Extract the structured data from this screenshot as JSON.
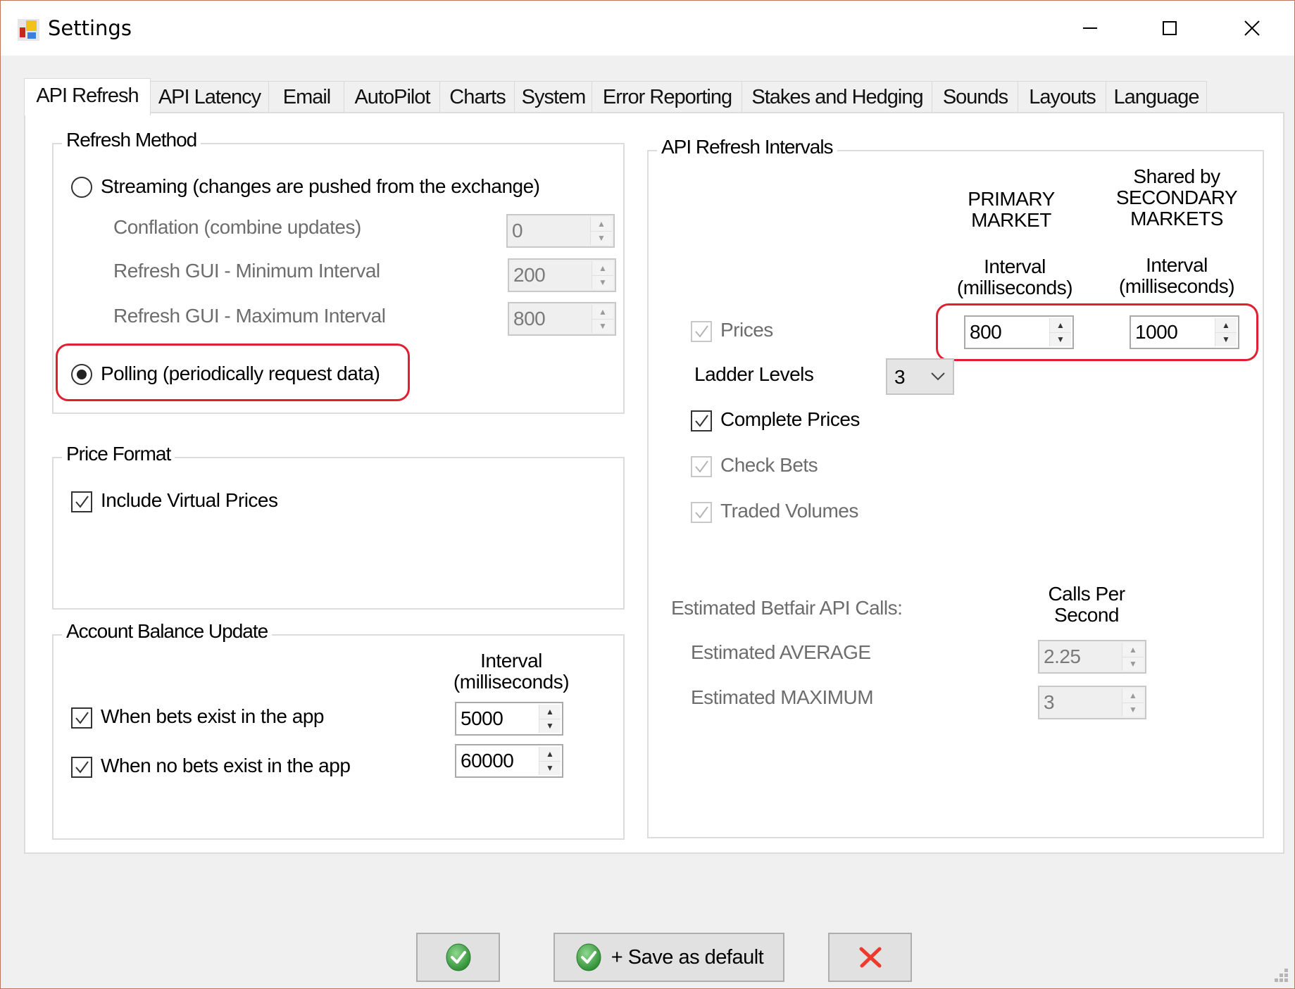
{
  "window": {
    "title": "Settings",
    "controls": {
      "minimize": "minimize-icon",
      "maximize": "maximize-icon",
      "close": "close-icon"
    }
  },
  "tabs": [
    {
      "label": "API Refresh",
      "active": true
    },
    {
      "label": "API Latency",
      "active": false
    },
    {
      "label": "Email",
      "active": false
    },
    {
      "label": "AutoPilot",
      "active": false
    },
    {
      "label": "Charts",
      "active": false
    },
    {
      "label": "System",
      "active": false
    },
    {
      "label": "Error Reporting",
      "active": false
    },
    {
      "label": "Stakes and Hedging",
      "active": false
    },
    {
      "label": "Sounds",
      "active": false
    },
    {
      "label": "Layouts",
      "active": false
    },
    {
      "label": "Language",
      "active": false
    }
  ],
  "refresh_method": {
    "title": "Refresh Method",
    "streaming": {
      "label": "Streaming (changes are pushed from the exchange)",
      "selected": false
    },
    "conflation": {
      "label": "Conflation (combine updates)",
      "value": "0",
      "enabled": false
    },
    "gui_min": {
      "label": "Refresh GUI - Minimum Interval",
      "value": "200",
      "enabled": false
    },
    "gui_max": {
      "label": "Refresh GUI - Maximum Interval",
      "value": "800",
      "enabled": false
    },
    "polling": {
      "label": "Polling (periodically request data)",
      "selected": true,
      "highlighted": true
    }
  },
  "price_format": {
    "title": "Price Format",
    "include_virtual": {
      "label": "Include Virtual Prices",
      "checked": true
    }
  },
  "account_balance": {
    "title": "Account Balance Update",
    "interval_header_1": "Interval",
    "interval_header_2": "(milliseconds)",
    "with_bets": {
      "label": "When bets exist in the app",
      "checked": true,
      "value": "5000"
    },
    "no_bets": {
      "label": "When no bets exist in the app",
      "checked": true,
      "value": "60000"
    }
  },
  "intervals": {
    "title": "API Refresh Intervals",
    "primary_header_1": "PRIMARY",
    "primary_header_2": "MARKET",
    "secondary_header_0": "Shared by",
    "secondary_header_1": "SECONDARY",
    "secondary_header_2": "MARKETS",
    "interval_header_1": "Interval",
    "interval_header_2": "(milliseconds)",
    "prices": {
      "label": "Prices",
      "checked": true,
      "enabled": false,
      "primary_value": "800",
      "secondary_value": "1000"
    },
    "ladder_levels": {
      "label": "Ladder Levels",
      "value": "3"
    },
    "complete_prices": {
      "label": "Complete Prices",
      "checked": true,
      "enabled": true
    },
    "check_bets": {
      "label": "Check Bets",
      "checked": true,
      "enabled": false
    },
    "traded_volumes": {
      "label": "Traded Volumes",
      "checked": true,
      "enabled": false
    },
    "estimated_title": "Estimated Betfair API Calls:",
    "calls_header_1": "Calls Per",
    "calls_header_2": "Second",
    "average": {
      "label": "Estimated AVERAGE",
      "value": "2.25"
    },
    "maximum": {
      "label": "Estimated MAXIMUM",
      "value": "3"
    }
  },
  "buttons": {
    "ok": {
      "icon": "green-check-icon"
    },
    "save_default": {
      "icon": "green-check-icon",
      "label": "+ Save as default"
    },
    "cancel": {
      "icon": "red-x-icon"
    }
  },
  "colors": {
    "highlight": "#e02030",
    "window_border": "#b9785e",
    "check_green": "#3e9a3e",
    "cancel_red": "#e8332a"
  }
}
